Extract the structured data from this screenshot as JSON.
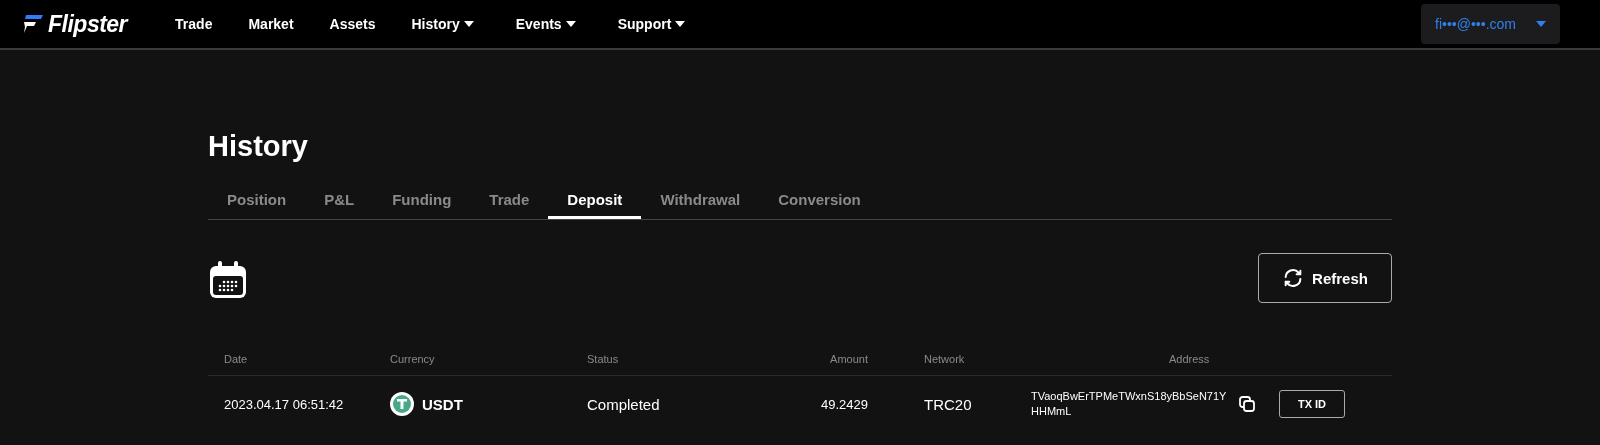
{
  "brand": "Flipster",
  "nav": [
    {
      "label": "Trade",
      "dropdown": false
    },
    {
      "label": "Market",
      "dropdown": false
    },
    {
      "label": "Assets",
      "dropdown": false
    },
    {
      "label": "History",
      "dropdown": true
    },
    {
      "label": "Events",
      "dropdown": true
    },
    {
      "label": "Support",
      "dropdown": true
    }
  ],
  "account": {
    "email": "fi•••@•••.com"
  },
  "page_title": "History",
  "tabs": [
    {
      "label": "Position",
      "selected": false
    },
    {
      "label": "P&L",
      "selected": false
    },
    {
      "label": "Funding",
      "selected": false
    },
    {
      "label": "Trade",
      "selected": false
    },
    {
      "label": "Deposit",
      "selected": true
    },
    {
      "label": "Withdrawal",
      "selected": false
    },
    {
      "label": "Conversion",
      "selected": false
    }
  ],
  "refresh_button": "Refresh",
  "table": {
    "columns": [
      "Date",
      "Currency",
      "Status",
      "Amount",
      "Network",
      "Address"
    ],
    "rows": [
      {
        "date": "2023.04.17 06:51:42",
        "currency": "USDT",
        "status": "Completed",
        "amount": "49.2429",
        "network": "TRC20",
        "address": "TVaoqBwErTPMeTWxnS18yBbSeN71YHHMmL",
        "action": "TX ID"
      }
    ]
  }
}
